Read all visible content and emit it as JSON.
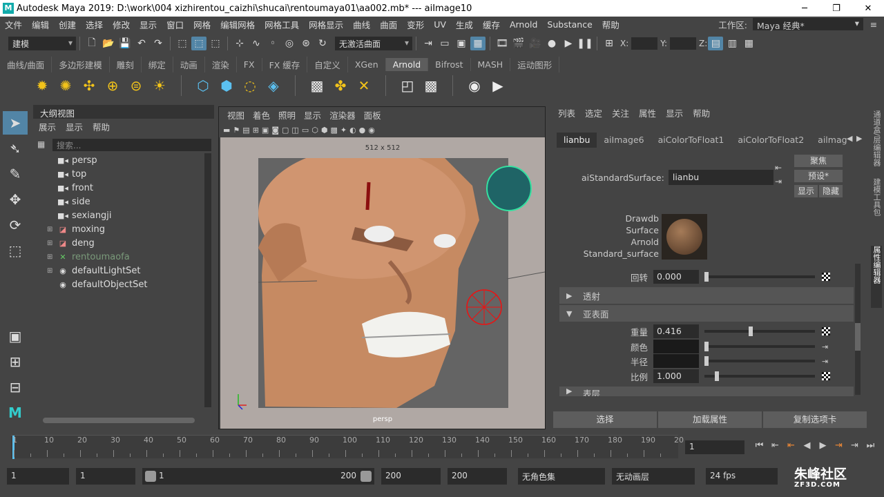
{
  "window": {
    "title": "Autodesk Maya 2019: D:\\work\\004 xizhirentou_caizhi\\shucai\\rentoumaya01\\aa002.mb*   ---   aiImage10",
    "logo": "M"
  },
  "menu": [
    "文件",
    "编辑",
    "创建",
    "选择",
    "修改",
    "显示",
    "窗口",
    "网格",
    "编辑网格",
    "网格工具",
    "网格显示",
    "曲线",
    "曲面",
    "变形",
    "UV",
    "生成",
    "缓存",
    "Arnold",
    "Substance",
    "帮助"
  ],
  "workspace": {
    "label": "工作区:",
    "value": "Maya 经典*"
  },
  "status": {
    "mode": "建模",
    "live": "无激活曲面",
    "x": "X:",
    "y": "Y:",
    "z": "Z:"
  },
  "shelf_tabs": [
    "曲线/曲面",
    "多边形建模",
    "雕刻",
    "绑定",
    "动画",
    "渲染",
    "FX",
    "FX 缓存",
    "自定义",
    "XGen",
    "Arnold",
    "Bifrost",
    "MASH",
    "运动图形"
  ],
  "shelf_active": "Arnold",
  "outliner": {
    "title": "大纲视图",
    "menu": [
      "展示",
      "显示",
      "帮助"
    ],
    "search_placeholder": "搜索...",
    "items": [
      {
        "label": "persp",
        "icon": "camera-icon",
        "expand": ""
      },
      {
        "label": "top",
        "icon": "camera-icon",
        "expand": ""
      },
      {
        "label": "front",
        "icon": "camera-icon",
        "expand": ""
      },
      {
        "label": "side",
        "icon": "camera-icon",
        "expand": ""
      },
      {
        "label": "sexiangji",
        "icon": "camera-icon",
        "expand": ""
      },
      {
        "label": "moxing",
        "icon": "mesh-icon",
        "expand": "⊞"
      },
      {
        "label": "deng",
        "icon": "mesh-icon",
        "expand": "⊞"
      },
      {
        "label": "rentoumaofa",
        "icon": "xgen-icon",
        "expand": "⊞"
      },
      {
        "label": "defaultLightSet",
        "icon": "set-icon",
        "expand": "⊞"
      },
      {
        "label": "defaultObjectSet",
        "icon": "set-icon",
        "expand": ""
      }
    ]
  },
  "viewport": {
    "menu": [
      "视图",
      "着色",
      "照明",
      "显示",
      "渲染器",
      "面板"
    ],
    "resolution": "512 x 512",
    "camera": "persp"
  },
  "attr": {
    "menu": [
      "列表",
      "选定",
      "关注",
      "属性",
      "显示",
      "帮助"
    ],
    "tabs": [
      "lianbu",
      "aiImage6",
      "aiColorToFloat1",
      "aiColorToFloat2",
      "ailmag"
    ],
    "node_label": "aiStandardSurface:",
    "node_name": "lianbu",
    "focus_btn": "聚焦",
    "preset_btn": "预设*",
    "show_btn": "显示",
    "hide_btn": "隐藏",
    "swatch_lines": [
      "Drawdb",
      "Surface",
      "Arnold",
      "Standard_surface"
    ],
    "rotation": {
      "label": "回转",
      "value": "0.000",
      "level": 0.0
    },
    "sect_transmission": "透射",
    "sect_subsurface": "亚表面",
    "weight": {
      "label": "重量",
      "value": "0.416",
      "level": 0.416
    },
    "color": {
      "label": "颜色"
    },
    "radius": {
      "label": "半径"
    },
    "scale": {
      "label": "比例",
      "value": "1.000",
      "level": 0.1
    },
    "sect_coat": "表层",
    "buttons": [
      "选择",
      "加载属性",
      "复制选项卡"
    ]
  },
  "side_tabs": [
    "通道盒/层编辑器",
    "建模工具包",
    "属性编辑器"
  ],
  "timeline": {
    "ticks": [
      "1",
      "10",
      "20",
      "30",
      "40",
      "50",
      "60",
      "70",
      "80",
      "90",
      "100",
      "110",
      "120",
      "130",
      "140",
      "150",
      "160",
      "170",
      "180",
      "190",
      "20"
    ],
    "current": "1"
  },
  "range": {
    "start": "1",
    "start2": "1",
    "slider_l": "1",
    "slider_r": "200",
    "end": "200",
    "end2": "200",
    "charset": "无角色集",
    "anim_layer": "无动画层",
    "fps": "24 fps"
  },
  "watermark": {
    "main": "朱峰社区",
    "sub": "ZF3D.COM"
  }
}
